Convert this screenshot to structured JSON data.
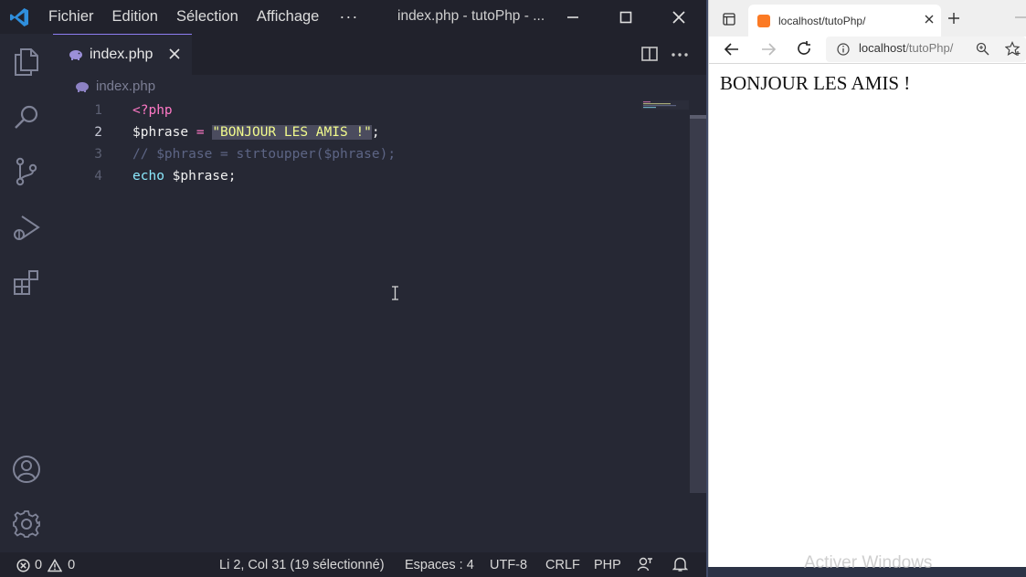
{
  "vscode": {
    "menu": [
      "Fichier",
      "Edition",
      "Sélection",
      "Affichage"
    ],
    "menu_more": "···",
    "window_title": "index.php - tutoPhp - ...",
    "tab": {
      "label": "index.php"
    },
    "breadcrumb": "index.php",
    "code": {
      "line_numbers": [
        "1",
        "2",
        "3",
        "4"
      ],
      "line1": "<?php",
      "line2": {
        "var": "$phrase",
        "op": " = ",
        "str": "\"BONJOUR LES AMIS !\"",
        "end": ";"
      },
      "line3": "// $phrase = strtoupper($phrase);",
      "line4": {
        "kw": "echo",
        "rest": " $phrase;"
      }
    },
    "status": {
      "errors": "0",
      "warnings": "0",
      "position": "Li 2, Col 31 (19 sélectionné)",
      "spaces": "Espaces : 4",
      "encoding": "UTF-8",
      "eol": "CRLF",
      "language": "PHP"
    },
    "colors": {
      "background": "#262834",
      "titlebar": "#21222c",
      "accent": "#8e7ef2",
      "string": "#f1fa8c",
      "tag": "#ff79c6"
    }
  },
  "browser": {
    "tab_title": "localhost/tutoPhp/",
    "url_host": "localhost",
    "url_path": "/tutoPhp/",
    "content": "BONJOUR LES AMIS !"
  },
  "watermark": "Activer Windows"
}
